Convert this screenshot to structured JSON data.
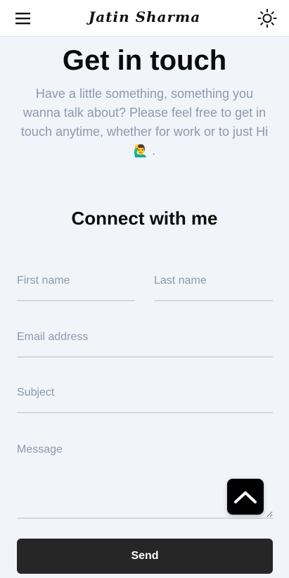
{
  "header": {
    "brand": "Jatin Sharma",
    "menu_icon": "hamburger-menu-icon",
    "theme_icon": "sun-icon"
  },
  "hero": {
    "title": "Get in touch",
    "intro": "Have a little something, something you wanna talk about? Please feel free to get in touch anytime, whether for work or to just Hi",
    "emoji": "🙋‍♂️",
    "trailing": "."
  },
  "form": {
    "title": "Connect with me",
    "first_name_placeholder": "First name",
    "last_name_placeholder": "Last name",
    "email_placeholder": "Email address",
    "subject_placeholder": "Subject",
    "message_placeholder": "Message",
    "submit_label": "Send"
  },
  "scroll_top": {
    "icon": "chevron-up-icon"
  },
  "colors": {
    "background": "#f1f4f9",
    "text_primary": "#0b0b0b",
    "text_muted": "#8d9aae",
    "button_bg": "#262626",
    "divider": "#d5d9df"
  }
}
